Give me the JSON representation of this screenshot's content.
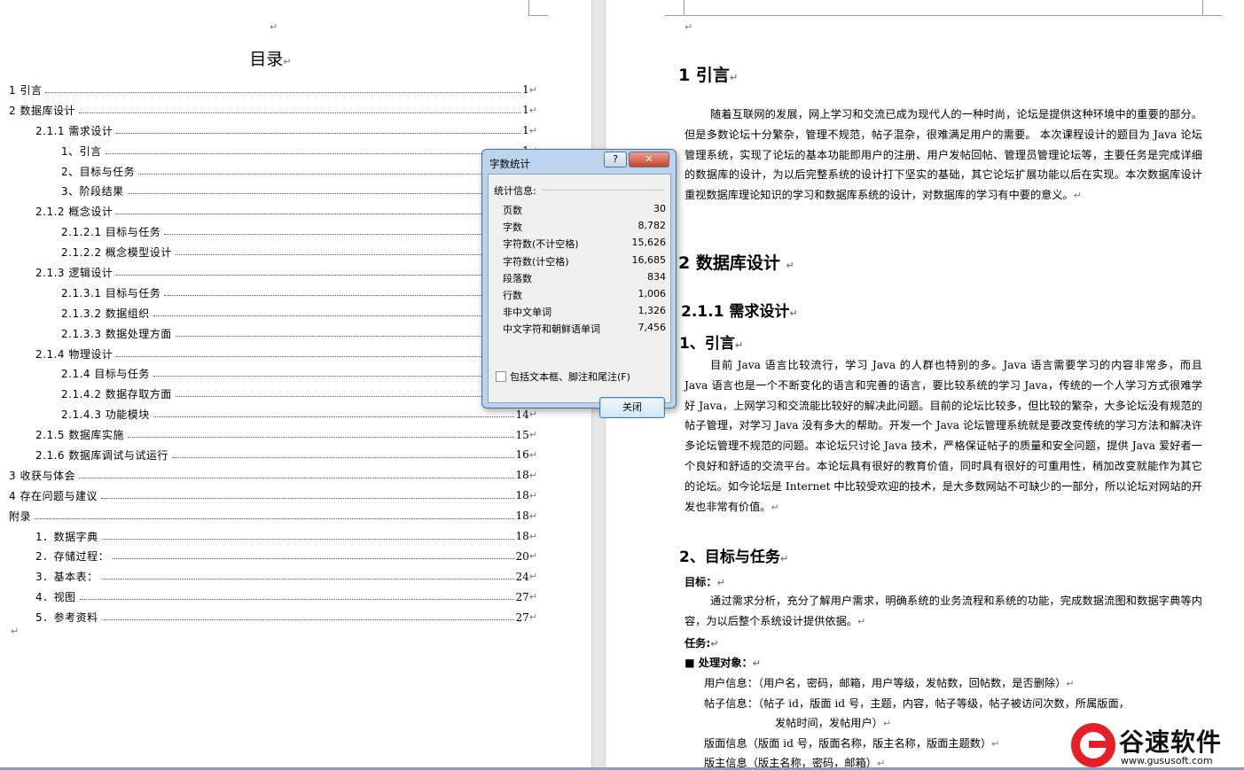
{
  "toc": {
    "title": "目录",
    "entries": [
      {
        "text": "1  引言",
        "page": "1",
        "level": 0
      },
      {
        "text": "2  数据库设计",
        "page": "1",
        "level": 0
      },
      {
        "text": "2.1.1 需求设计",
        "page": "1",
        "level": 1
      },
      {
        "text": "1、引言",
        "page": "1",
        "level": 2
      },
      {
        "text": "2、目标与任务",
        "page": "",
        "level": 2
      },
      {
        "text": "3、阶段结果",
        "page": "",
        "level": 2
      },
      {
        "text": "2.1.2 概念设计",
        "page": "",
        "level": 1
      },
      {
        "text": "2.1.2.1 目标与任务",
        "page": "",
        "level": 2
      },
      {
        "text": "2.1.2.2 概念模型设计",
        "page": "",
        "level": 2
      },
      {
        "text": "2.1.3 逻辑设计",
        "page": "",
        "level": 1
      },
      {
        "text": "2.1.3.1 目标与任务",
        "page": "",
        "level": 2
      },
      {
        "text": "2.1.3.2 数据组织",
        "page": "",
        "level": 2
      },
      {
        "text": "2.1.3.3 数据处理方面",
        "page": "",
        "level": 2
      },
      {
        "text": "2.1.4 物理设计",
        "page": "",
        "level": 1
      },
      {
        "text": "2.1.4 目标与任务",
        "page": "",
        "level": 2
      },
      {
        "text": "2.1.4.2 数据存取方面",
        "page": "",
        "level": 2
      },
      {
        "text": "2.1.4.3 功能模块",
        "page": "14",
        "level": 2
      },
      {
        "text": "2.1.5 数据库实施",
        "page": "15",
        "level": 1
      },
      {
        "text": "2.1.6 数据库调试与试运行",
        "page": "16",
        "level": 1
      },
      {
        "text": "3  收获与体会",
        "page": "18",
        "level": 0
      },
      {
        "text": "4  存在问题与建议",
        "page": "18",
        "level": 0
      },
      {
        "text": "附录",
        "page": "18",
        "level": 0
      },
      {
        "text": "1．数据字典",
        "page": "18",
        "level": 1
      },
      {
        "text": "2．存储过程：",
        "page": "20",
        "level": 1
      },
      {
        "text": "3．基本表：",
        "page": "24",
        "level": 1
      },
      {
        "text": "4．视图",
        "page": "27",
        "level": 1
      },
      {
        "text": "5．参考资料",
        "page": "27",
        "level": 1
      }
    ]
  },
  "doc": {
    "h_intro": "1  引言",
    "p_intro": "随着互联网的发展，网上学习和交流已成为现代人的一种时尚，论坛是提供这种环境中的重要的部分。但是多数论坛十分繁杂，管理不规范，帖子混杂，很难满足用户的需要。 本次课程设计的题目为 Java 论坛管理系统，实现了论坛的基本功能即用户的注册、用户发帖回帖、管理员管理论坛等，主要任务是完成详细的数据库的设计，为以后完整系统的设计打下坚实的基础，其它论坛扩展功能以后在实现。本次数据库设计重视数据库理论知识的学习和数据库系统的设计，对数据库的学习有中要的意义。",
    "h_db": "2  数据库设计",
    "h_req": "2.1.1 需求设计",
    "h_sub_intro": "1、引言",
    "p_sub_intro": "目前 Java 语言比较流行，学习 Java 的人群也特别的多。Java 语言需要学习的内容非常多，而且 Java 语言也是一个不断变化的语言和完善的语言，要比较系统的学习 Java，传统的一个人学习方式很难学好 Java，上网学习和交流能比较好的解决此问题。目前的论坛比较多，但比较的繁杂，大多论坛没有规范的帖子管理，对学习 Java 没有多大的帮助。开发一个 Java 论坛管理系统就是要改变传统的学习方法和解决许多论坛管理不规范的问题。本论坛只讨论 Java 技术，严格保证帖子的质量和安全问题，提供 Java 爱好者一个良好和舒适的交流平台。本论坛具有很好的教育价值，同时具有很好的可重用性，稍加改变就能作为其它的论坛。如今论坛是 Internet 中比较受欢迎的技术，是大多数网站不可缺少的一部分，所以论坛对网站的开发也非常有价值。",
    "h_goal": "2、目标与任务",
    "goal_label": "目标：",
    "p_goal": "通过需求分析，充分了解用户需求，明确系统的业务流程和系统的功能，完成数据流图和数据字典等内容，为以后整个系统设计提供依据。",
    "task_label": "任务:",
    "objects_label": "■ 处理对象：",
    "obj_user": "用户信息：（用户名，密码，邮箱，用户等级，发帖数，回帖数，是否删除）",
    "obj_post_1": "帖子信息：（帖子 id，版面 id 号，主题，内容，帖子等级，帖子被访问次数，所属版面，",
    "obj_post_2": "发帖时间，发帖用户）",
    "obj_board": "版面信息（版面 id 号，版面名称，版主名称，版面主题数）",
    "obj_mod": "版主信息（版主名称，密码，邮箱）"
  },
  "dialog": {
    "title": "字数统计",
    "help_label": "?",
    "close_x": "✕",
    "stats_label": "统计信息:",
    "stats": [
      {
        "k": "页数",
        "v": "30"
      },
      {
        "k": "字数",
        "v": "8,782"
      },
      {
        "k": "字符数(不计空格)",
        "v": "15,626"
      },
      {
        "k": "字符数(计空格)",
        "v": "16,685"
      },
      {
        "k": "段落数",
        "v": "834"
      },
      {
        "k": "行数",
        "v": "1,006"
      },
      {
        "k": "非中文单词",
        "v": "1,326"
      },
      {
        "k": "中文字符和朝鲜语单词",
        "v": "7,456"
      }
    ],
    "checkbox_label": "包括文本框、脚注和尾注(F)",
    "close_label": "关闭"
  },
  "marks": {
    "para": "↵"
  },
  "logo": {
    "text": "谷速软件",
    "url": "www.gususoft.com"
  }
}
